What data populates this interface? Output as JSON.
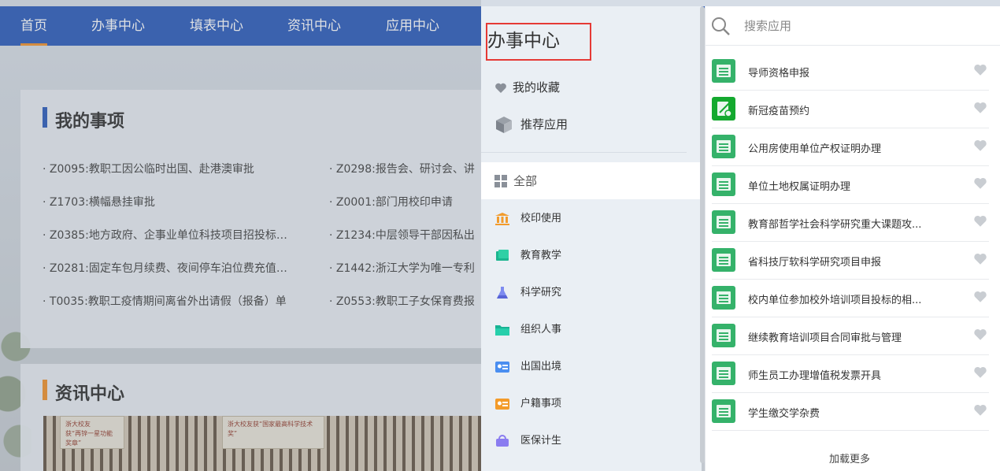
{
  "topnav": {
    "items": [
      "首页",
      "办事中心",
      "填表中心",
      "资讯中心",
      "应用中心"
    ]
  },
  "my_items": {
    "title": "我的事项",
    "left": [
      "· Z0095:教职工因公临时出国、赴港澳审批",
      "· Z1703:横幅悬挂审批",
      "· Z0385:地方政府、企事业单位科技项目招投标…",
      "· Z0281:固定车包月续费、夜间停车泊位费充值…",
      "· T0035:教职工疫情期间离省外出请假（报备）单"
    ],
    "right": [
      "· Z0298:报告会、研讨会、讲",
      "· Z0001:部门用校印申请",
      "· Z1234:中层领导干部因私出",
      "· Z1442:浙江大学为唯一专利",
      "· Z0553:教职工子女保育费报"
    ]
  },
  "news": {
    "title": "资讯中心",
    "card1_line1": "浙大校友",
    "card1_line2": "获“再锌一星功能奖章”",
    "card2_line1": "浙大校友获“国家最高科学技术奖”"
  },
  "drawer": {
    "title": "办事中心",
    "favorites": "我的收藏",
    "recommended": "推荐应用",
    "all": "全部",
    "categories": [
      "校印使用",
      "教育教学",
      "科学研究",
      "组织人事",
      "出国出境",
      "户籍事项",
      "医保计生"
    ]
  },
  "search": {
    "placeholder": "搜索应用"
  },
  "apps": [
    "导师资格申报",
    "新冠疫苗预约",
    "公用房使用单位产权证明办理",
    "单位土地权属证明办理",
    "教育部哲学社会科学研究重大课题攻...",
    "省科技厅软科学研究项目申报",
    "校内单位参加校外培训项目投标的相...",
    "继续教育培训项目合同审批与管理",
    "师生员工办理增值税发票开具",
    "学生缴交学杂费"
  ],
  "load_more": "加载更多",
  "colors": {
    "nav_blue": "#1d4fb6",
    "accent_orange": "#f08a1c",
    "app_green": "#35b26a",
    "highlight_red": "#e53935"
  }
}
